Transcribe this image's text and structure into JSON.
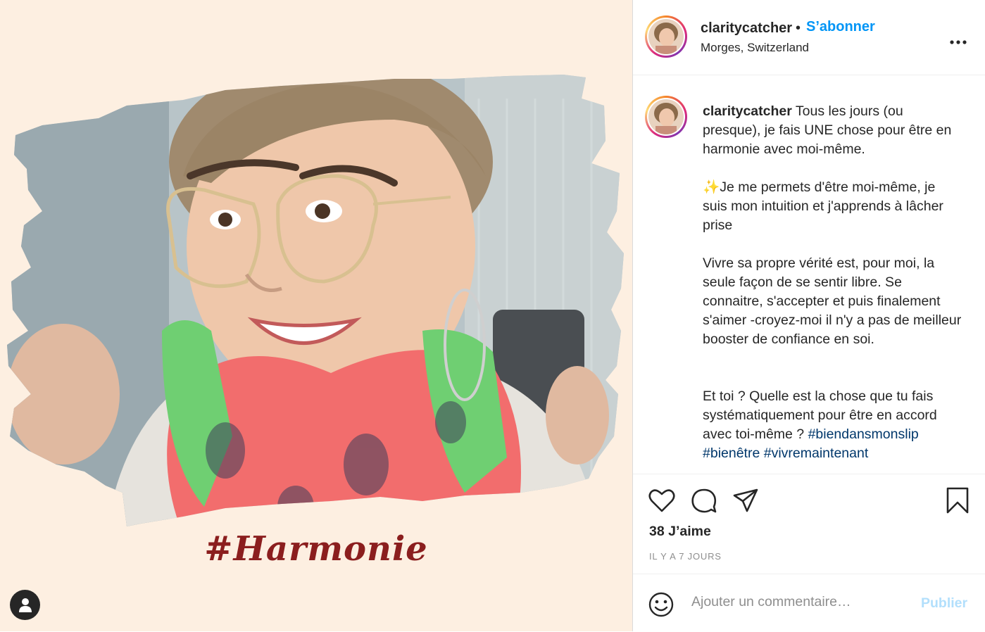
{
  "media": {
    "hashtag_art_text": "#Harmonie",
    "background_color": "#fdefe1",
    "accent_color": "#8b1e1e",
    "tag_icon": "user-icon"
  },
  "header": {
    "username": "claritycatcher",
    "separator": "•",
    "follow_label": "S’abonner",
    "location": "Morges, Switzerland",
    "more_icon": "more-options-icon"
  },
  "caption": {
    "username": "claritycatcher",
    "paragraph_1": "Tous les jours (ou presque), je fais UNE chose pour être en harmonie avec moi-même.",
    "paragraph_2": "✨Je me permets d'être moi-même, je suis mon intuition et j'apprends à lâcher prise",
    "paragraph_3": "Vivre sa propre vérité est, pour moi, la seule façon de se sentir libre. Se connaitre, s'accepter et puis finalement s'aimer -croyez-moi il n'y a pas de meilleur booster de confiance en soi.",
    "paragraph_4": "Et toi ? Quelle est la chose que tu fais systématiquement pour être en accord avec toi-même ?",
    "hashtags": [
      "#biendansmonslip",
      "#bienêtre",
      "#vivremaintenant"
    ]
  },
  "actions": {
    "like_icon": "heart-icon",
    "comment_icon": "comment-icon",
    "share_icon": "share-icon",
    "save_icon": "bookmark-icon",
    "likes": "38 J’aime",
    "timestamp": "IL Y A 7 JOURS"
  },
  "comment_bar": {
    "emoji_icon": "emoji-icon",
    "placeholder": "Ajouter un commentaire…",
    "publish_label": "Publier",
    "publish_color": "#b2dffc",
    "link_color": "#0095f6"
  }
}
